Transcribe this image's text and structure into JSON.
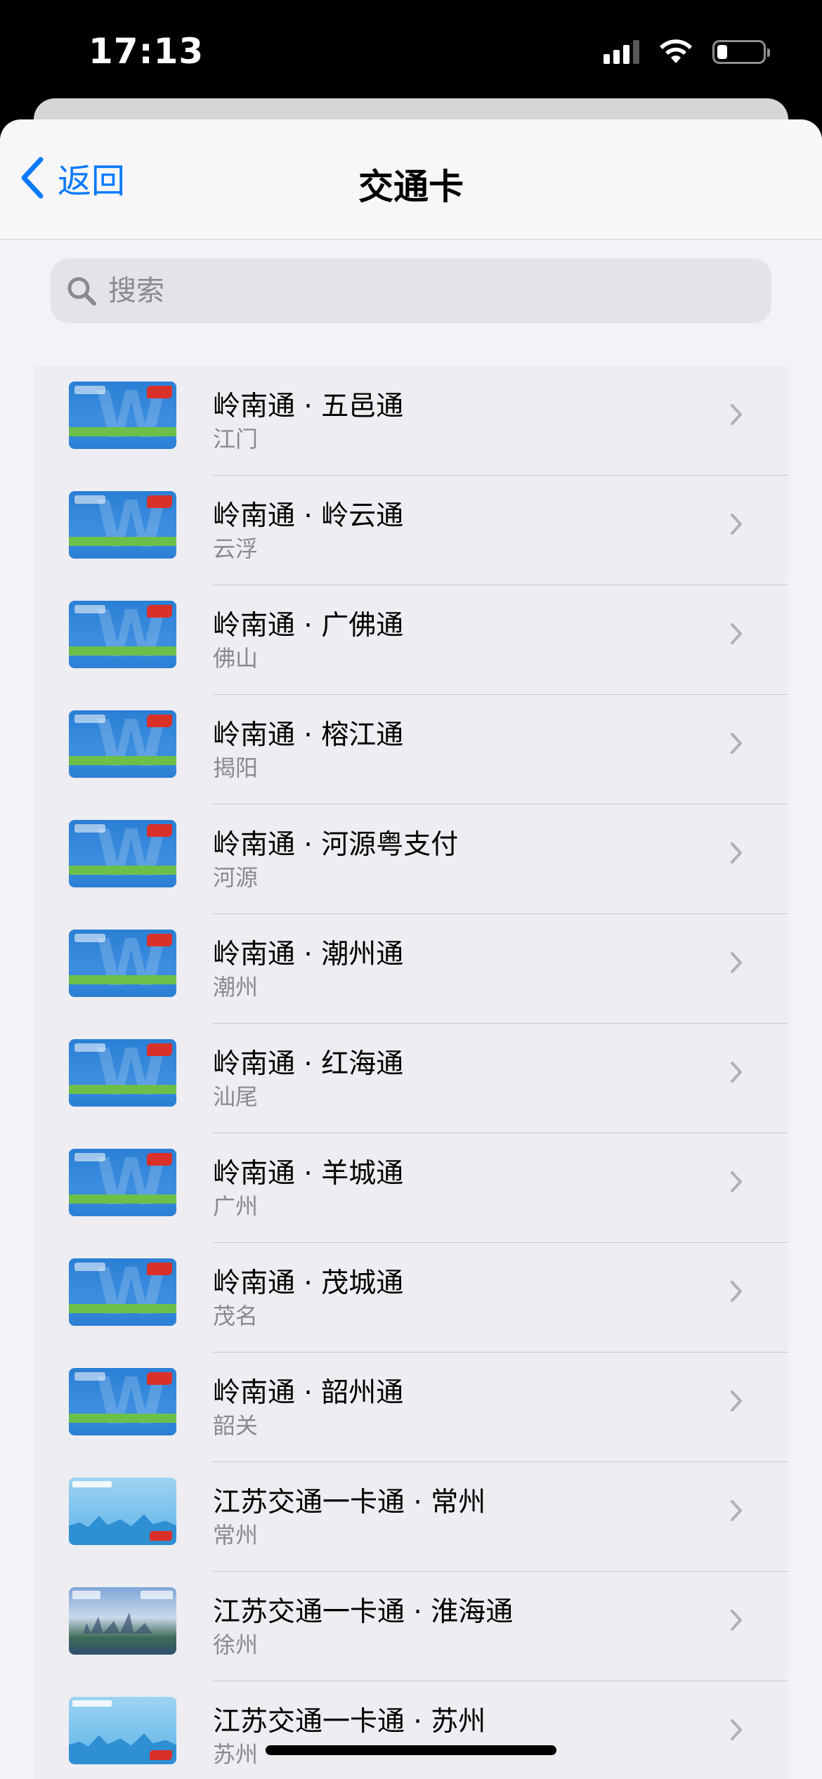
{
  "status_bar": {
    "time": "17:13"
  },
  "nav": {
    "back_label": "返回",
    "title": "交通卡"
  },
  "search": {
    "placeholder": "搜索"
  },
  "cards": [
    {
      "title": "岭南通 · 五邑通",
      "subtitle": "江门",
      "style": "lingnan"
    },
    {
      "title": "岭南通 · 岭云通",
      "subtitle": "云浮",
      "style": "lingnan"
    },
    {
      "title": "岭南通 · 广佛通",
      "subtitle": "佛山",
      "style": "lingnan"
    },
    {
      "title": "岭南通 · 榕江通",
      "subtitle": "揭阳",
      "style": "lingnan"
    },
    {
      "title": "岭南通 · 河源粤支付",
      "subtitle": "河源",
      "style": "lingnan"
    },
    {
      "title": "岭南通 · 潮州通",
      "subtitle": "潮州",
      "style": "lingnan"
    },
    {
      "title": "岭南通 · 红海通",
      "subtitle": "汕尾",
      "style": "lingnan"
    },
    {
      "title": "岭南通 · 羊城通",
      "subtitle": "广州",
      "style": "lingnan"
    },
    {
      "title": "岭南通 · 茂城通",
      "subtitle": "茂名",
      "style": "lingnan"
    },
    {
      "title": "岭南通 · 韶州通",
      "subtitle": "韶关",
      "style": "lingnan"
    },
    {
      "title": "江苏交通一卡通 · 常州",
      "subtitle": "常州",
      "style": "jiangsu"
    },
    {
      "title": "江苏交通一卡通 · 淮海通",
      "subtitle": "徐州",
      "style": "huaihai"
    },
    {
      "title": "江苏交通一卡通 · 苏州",
      "subtitle": "苏州",
      "style": "jiangsu"
    }
  ],
  "colors": {
    "accent": "#0a7aff",
    "secondary_text": "#8a8a8e",
    "background": "#f2f2f7"
  }
}
